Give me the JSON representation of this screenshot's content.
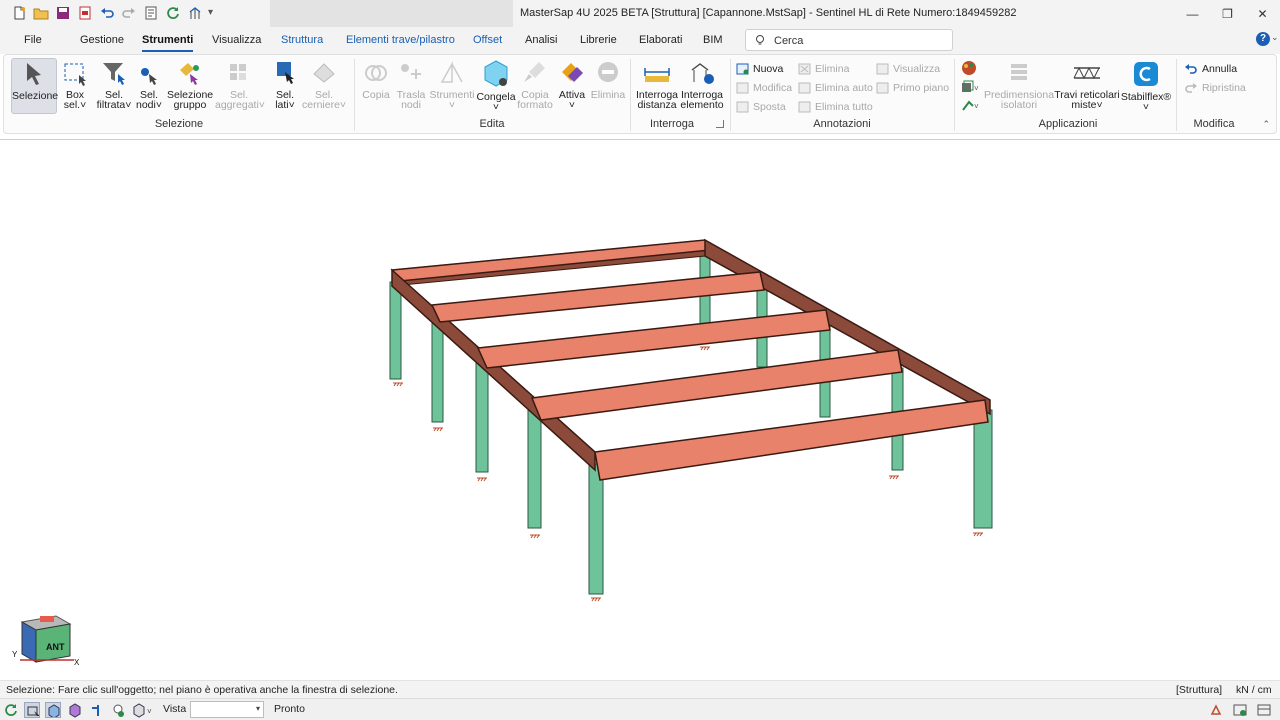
{
  "window": {
    "title": "MasterSap 4U 2025 BETA [Struttura] [Capannone.MstSap]  - Sentinel HL di Rete Numero:1849459282",
    "controls": [
      "minimize-icon",
      "maximize-icon",
      "close-icon"
    ]
  },
  "quick_access": [
    "new-file-icon",
    "open-folder-icon",
    "save-icon",
    "pdf-icon",
    "undo-icon",
    "redo-icon",
    "report-icon",
    "refresh-icon",
    "structure-icon"
  ],
  "tabs": [
    {
      "label": "File"
    },
    {
      "label": "Gestione"
    },
    {
      "label": "Strumenti",
      "active": true
    },
    {
      "label": "Visualizza"
    },
    {
      "label": "Struttura"
    },
    {
      "label": "Elementi trave/pilastro"
    },
    {
      "label": "Offset"
    },
    {
      "label": "Analisi"
    },
    {
      "label": "Librerie"
    },
    {
      "label": "Elaborati"
    },
    {
      "label": "BIM"
    }
  ],
  "search": {
    "placeholder": "Cerca"
  },
  "help": "?",
  "ribbon": {
    "selezione": {
      "label": "Selezione",
      "buttons": [
        {
          "line1": "Selezione",
          "line2": ""
        },
        {
          "line1": "Box",
          "line2": "sel.˅"
        },
        {
          "line1": "Sel.",
          "line2": "filtrata˅"
        },
        {
          "line1": "Sel.",
          "line2": "nodi˅"
        },
        {
          "line1": "Selezione",
          "line2": "gruppo"
        },
        {
          "line1": "Sel.",
          "line2": "aggregati˅"
        },
        {
          "line1": "Sel.",
          "line2": "lati˅"
        },
        {
          "line1": "Sel.",
          "line2": "cerniere˅"
        }
      ]
    },
    "edita": {
      "label": "Edita",
      "buttons": [
        {
          "line1": "Copia",
          "line2": ""
        },
        {
          "line1": "Trasla",
          "line2": "nodi"
        },
        {
          "line1": "Strumenti",
          "line2": "˅"
        },
        {
          "line1": "Congela",
          "line2": "˅"
        },
        {
          "line1": "Copia",
          "line2": "formato"
        },
        {
          "line1": "Attiva",
          "line2": "˅"
        },
        {
          "line1": "Elimina",
          "line2": ""
        }
      ]
    },
    "interroga": {
      "label": "Interroga",
      "buttons": [
        {
          "line1": "Interroga",
          "line2": "distanza"
        },
        {
          "line1": "Interroga",
          "line2": "elemento"
        }
      ]
    },
    "annotazioni": {
      "label": "Annotazioni",
      "items": [
        "Nuova",
        "Modifica",
        "Sposta",
        "Elimina",
        "Elimina auto",
        "Elimina tutto",
        "Visualizza",
        "Primo piano"
      ]
    },
    "applicazioni": {
      "label": "Applicazioni",
      "buttons": [
        {
          "line1": "Predimensiona",
          "line2": "isolatori"
        },
        {
          "line1": "Travi reticolari",
          "line2": "miste˅"
        },
        {
          "line1": "Stabilflex®",
          "line2": "˅"
        }
      ]
    },
    "modifica": {
      "label": "Modifica",
      "items": [
        "Annulla",
        "Ripristina"
      ]
    }
  },
  "viewport": {
    "model": "3d-frame-model",
    "colors": {
      "beam_top": "#e8826a",
      "beam_side": "#8b4a3a",
      "beam_edge": "#5a2a20",
      "column": "#6fc39a",
      "column_dark": "#3a8a64"
    },
    "view_cube": {
      "face": "ANT",
      "axis_x": "X",
      "axis_y": "Y"
    }
  },
  "status": {
    "message": "Selezione: Fare clic sull'oggetto; nel piano è operativa anche la finestra di selezione.",
    "mode": "[Struttura]",
    "units": "kN / cm"
  },
  "bottom": {
    "vista_label": "Vista :",
    "vista_value": "",
    "ready": "Pronto"
  }
}
